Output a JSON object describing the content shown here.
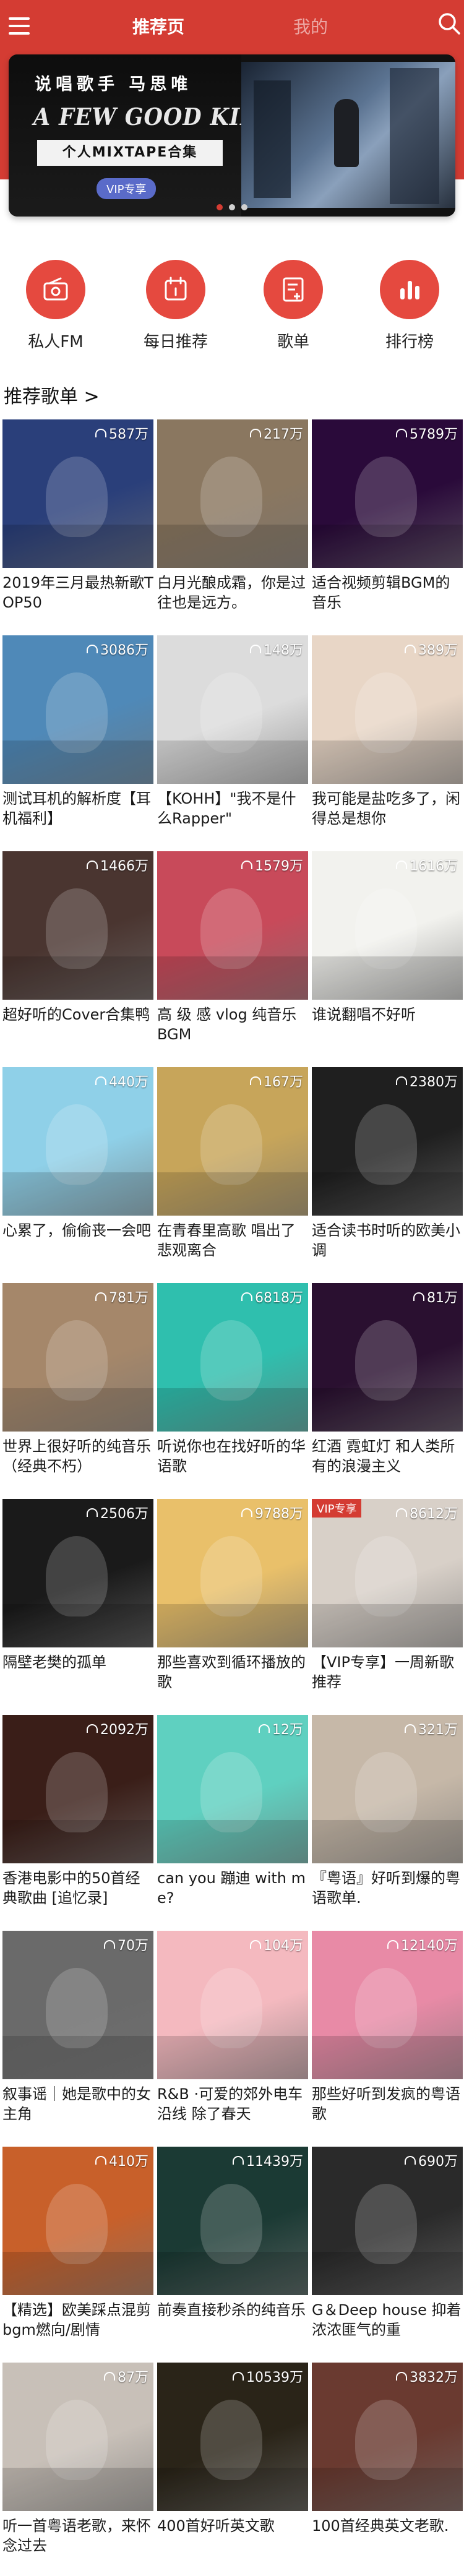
{
  "header": {
    "tab_recommend": "推荐页",
    "tab_mine": "我的",
    "background": "#d43c33",
    "menu_icon": "hamburger-menu-icon",
    "search_icon": "search-icon"
  },
  "banner": {
    "artist": "说唱歌手  马思唯",
    "album": "A FEW GOOD KIDS",
    "subtitle": "个人MIXTAPE合集",
    "vip_badge": "VIP专享",
    "dots": 3,
    "active_dot": 0
  },
  "quick_nav": [
    {
      "label": "私人FM",
      "icon": "radio-icon"
    },
    {
      "label": "每日推荐",
      "icon": "calendar-icon"
    },
    {
      "label": "歌单",
      "icon": "playlist-icon"
    },
    {
      "label": "排行榜",
      "icon": "chart-icon"
    }
  ],
  "section": {
    "title": "推荐歌单 >"
  },
  "playlists": [
    {
      "count": "587万",
      "title": "2019年三月最热新歌TOP50",
      "cover": "#2a3f7a"
    },
    {
      "count": "217万",
      "title": "白月光酿成霜，你是过往也是远方。",
      "cover": "#8a7760"
    },
    {
      "count": "5789万",
      "title": "适合视频剪辑BGM的音乐",
      "cover": "#2a0a3a"
    },
    {
      "count": "3086万",
      "title": "测试耳机的解析度【耳机福利】",
      "cover": "#4f89b8"
    },
    {
      "count": "148万",
      "title": "【KOHH】\"我不是什么Rapper\"",
      "cover": "#dcdcdc"
    },
    {
      "count": "389万",
      "title": "我可能是盐吃多了，闲得总是想你",
      "cover": "#e8d6c6"
    },
    {
      "count": "1466万",
      "title": "超好听的Cover合集鸭",
      "cover": "#4a3530"
    },
    {
      "count": "1579万",
      "title": "高 级 感 vlog 纯音乐 BGM",
      "cover": "#c84a5a"
    },
    {
      "count": "1616万",
      "title": "谁说翻唱不好听",
      "cover": "#f2f2ee"
    },
    {
      "count": "440万",
      "title": "心累了，偷偷丧一会吧",
      "cover": "#8fd0e8"
    },
    {
      "count": "167万",
      "title": "在青春里高歌 唱出了悲观离合",
      "cover": "#c7a55a"
    },
    {
      "count": "2380万",
      "title": "适合读书时听的欧美小调",
      "cover": "#1f1f1f"
    },
    {
      "count": "781万",
      "title": "世界上很好听的纯音乐（经典不朽）",
      "cover": "#a5876a"
    },
    {
      "count": "6818万",
      "title": "听说你也在找好听的华语歌",
      "cover": "#2fbfae"
    },
    {
      "count": "81万",
      "title": "红酒 霓虹灯 和人类所有的浪漫主义",
      "cover": "#2a1030"
    },
    {
      "count": "2506万",
      "title": "隔壁老樊的孤单",
      "cover": "#1a1a1a"
    },
    {
      "count": "9788万",
      "title": "那些喜欢到循环播放的歌",
      "cover": "#e9c06a"
    },
    {
      "count": "8612万",
      "title": "【VIP专享】一周新歌推荐",
      "cover": "#d8d0c8",
      "vip": "VIP专享"
    },
    {
      "count": "2092万",
      "title": "香港电影中的50首经典歌曲 [追忆录]",
      "cover": "#3a1e18"
    },
    {
      "count": "12万",
      "title": "can you 蹦迪 with me?",
      "cover": "#5fd0c0"
    },
    {
      "count": "321万",
      "title": "『粤语』好听到爆的粤语歌单.",
      "cover": "#c6b8a8"
    },
    {
      "count": "70万",
      "title": "叙事谣｜她是歌中的女主角",
      "cover": "#6a6a6a"
    },
    {
      "count": "104万",
      "title": "R&B ·可爱的郊外电车沿线 除了春天",
      "cover": "#f4b9bf"
    },
    {
      "count": "12140万",
      "title": "那些好听到发疯的粤语歌",
      "cover": "#e88aa6"
    },
    {
      "count": "410万",
      "title": "【精选】欧美踩点混剪bgm燃向/剧情",
      "cover": "#c8602a"
    },
    {
      "count": "11439万",
      "title": "前奏直接秒杀的纯音乐",
      "cover": "#1b3a34"
    },
    {
      "count": "690万",
      "title": "G＆Deep house 抑着浓浓匪气的重",
      "cover": "#2a2a2a"
    },
    {
      "count": "87万",
      "title": "听一首粤语老歌，来怀念过去",
      "cover": "#c8c0b8"
    },
    {
      "count": "10539万",
      "title": "400首好听英文歌",
      "cover": "#2a2418"
    },
    {
      "count": "3832万",
      "title": "100首经典英文老歌.",
      "cover": "#6a3a30"
    }
  ]
}
